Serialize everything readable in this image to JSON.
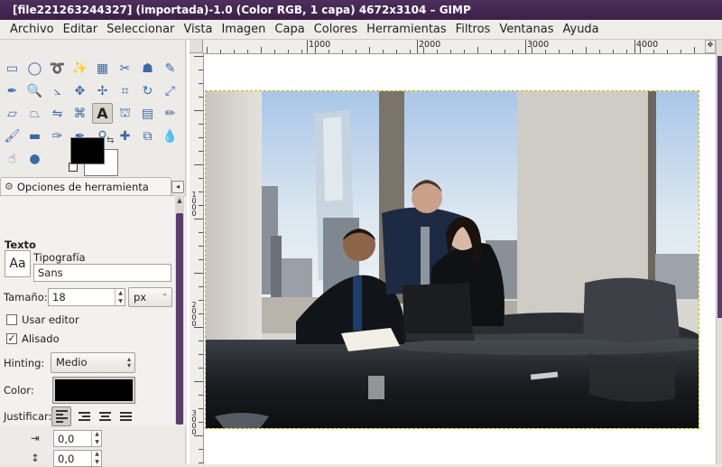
{
  "window": {
    "title": "[file221263244327] (importada)-1.0 (Color RGB, 1 capa) 4672x3104 – GIMP"
  },
  "menubar": {
    "items": [
      "Archivo",
      "Editar",
      "Seleccionar",
      "Vista",
      "Imagen",
      "Capa",
      "Colores",
      "Herramientas",
      "Filtros",
      "Ventanas",
      "Ayuda"
    ]
  },
  "toolbox": {
    "tools": [
      {
        "name": "rect-select-icon",
        "glyph": "▭"
      },
      {
        "name": "ellipse-select-icon",
        "glyph": "◯"
      },
      {
        "name": "free-select-icon",
        "glyph": "➰"
      },
      {
        "name": "fuzzy-select-icon",
        "glyph": "✨"
      },
      {
        "name": "select-by-color-icon",
        "glyph": "▦"
      },
      {
        "name": "scissors-select-icon",
        "glyph": "✂"
      },
      {
        "name": "foreground-select-icon",
        "glyph": "☗"
      },
      {
        "name": "paths-icon",
        "glyph": "✎"
      },
      {
        "name": "color-picker-icon",
        "glyph": "✒"
      },
      {
        "name": "zoom-icon",
        "glyph": "🔍"
      },
      {
        "name": "measure-icon",
        "glyph": "⦣"
      },
      {
        "name": "move-icon",
        "glyph": "✥"
      },
      {
        "name": "align-icon",
        "glyph": "✢"
      },
      {
        "name": "crop-icon",
        "glyph": "⌗"
      },
      {
        "name": "rotate-icon",
        "glyph": "↻"
      },
      {
        "name": "scale-icon",
        "glyph": "⤢"
      },
      {
        "name": "shear-icon",
        "glyph": "▱"
      },
      {
        "name": "perspective-icon",
        "glyph": "⏢"
      },
      {
        "name": "flip-icon",
        "glyph": "⇋"
      },
      {
        "name": "cage-icon",
        "glyph": "⌘"
      },
      {
        "name": "text-icon",
        "glyph": "A"
      },
      {
        "name": "bucket-fill-icon",
        "glyph": "⛫"
      },
      {
        "name": "blend-icon",
        "glyph": "▤"
      },
      {
        "name": "pencil-icon",
        "glyph": "✏"
      },
      {
        "name": "paintbrush-icon",
        "glyph": "🖌"
      },
      {
        "name": "eraser-icon",
        "glyph": "▬"
      },
      {
        "name": "airbrush-icon",
        "glyph": "✑"
      },
      {
        "name": "ink-icon",
        "glyph": "✒"
      },
      {
        "name": "clone-icon",
        "glyph": "⚲"
      },
      {
        "name": "heal-icon",
        "glyph": "✚"
      },
      {
        "name": "perspective-clone-icon",
        "glyph": "⧉"
      },
      {
        "name": "blur-icon",
        "glyph": "💧"
      },
      {
        "name": "smudge-icon",
        "glyph": "☝"
      },
      {
        "name": "dodge-burn-icon",
        "glyph": "●"
      }
    ],
    "active_tool_index": 20
  },
  "tool_options": {
    "tab_label": "Opciones de herramienta",
    "section_title": "Texto",
    "font_label": "Tipografía",
    "font_preview": "Aa",
    "font_value": "Sans",
    "size_label": "Tamaño:",
    "size_value": "18",
    "size_unit": "px",
    "use_editor_label": "Usar editor",
    "use_editor_checked": false,
    "antialias_label": "Alisado",
    "antialias_checked": true,
    "hinting_label": "Hinting:",
    "hinting_value": "Medio",
    "color_label": "Color:",
    "color_value": "#000000",
    "justify_label": "Justificar:",
    "indent_value": "0,0",
    "line_spacing_value": "0,0"
  },
  "ruler": {
    "top_labels": [
      "1000",
      "2000",
      "3000",
      "4000"
    ],
    "left_labels": [
      "1000",
      "2000",
      "3000"
    ]
  },
  "colors": {
    "accent": "#5a3d6b",
    "foreground": "#000000",
    "background": "#ffffff"
  }
}
